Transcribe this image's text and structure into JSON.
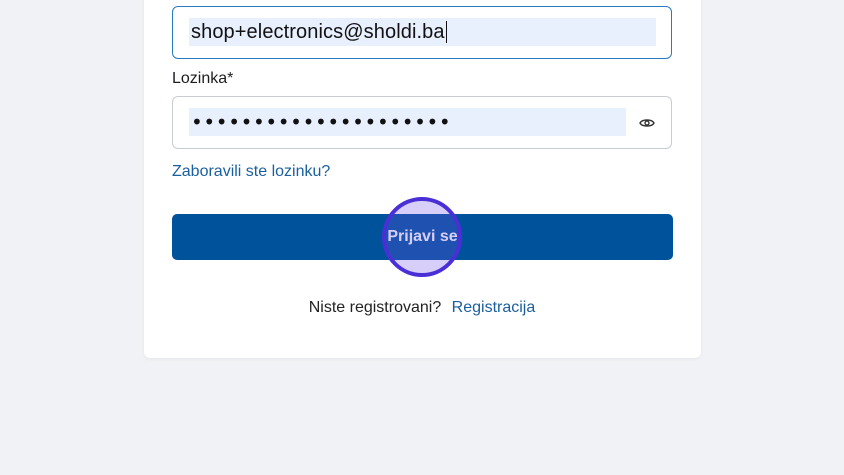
{
  "login_form": {
    "email": {
      "value": "shop+electronics@sholdi.ba"
    },
    "password": {
      "label": "Lozinka*",
      "masked_value": "•••••••••••••••••••••",
      "toggle_icon": "eye-icon"
    },
    "forgot_password_link": "Zaboravili ste lozinku?",
    "submit_button": "Prijavi se",
    "register": {
      "prompt": "Niste registrovani?",
      "link": "Registracija"
    }
  },
  "colors": {
    "primary": "#00539b",
    "link": "#1a5f9e",
    "autofill_bg": "#e8f0fe",
    "focus_border": "#2a7abf",
    "background": "#f1f2f5"
  }
}
